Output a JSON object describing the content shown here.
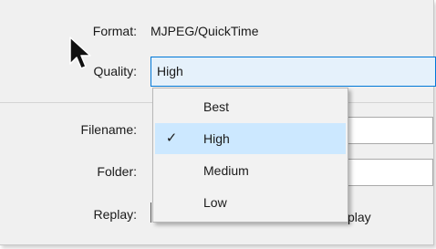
{
  "format": {
    "label": "Format:",
    "value": "MJPEG/QuickTime"
  },
  "quality": {
    "label": "Quality:",
    "value": "High"
  },
  "filename": {
    "label": "Filename:"
  },
  "folder": {
    "label": "Folder:"
  },
  "replay": {
    "label": "Replay:",
    "option_text_partial": "play"
  },
  "dropdown": {
    "options": [
      {
        "label": "Best",
        "selected": false
      },
      {
        "label": "High",
        "selected": true
      },
      {
        "label": "Medium",
        "selected": false
      },
      {
        "label": "Low",
        "selected": false
      }
    ],
    "check_glyph": "✓"
  },
  "colors": {
    "accent": "#0078d7",
    "selection": "#cce8ff"
  }
}
